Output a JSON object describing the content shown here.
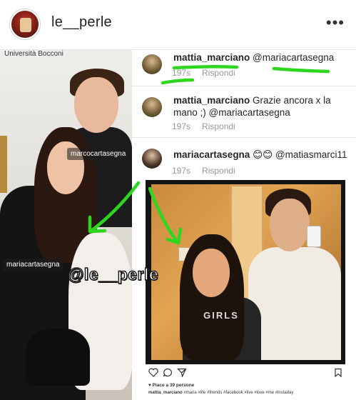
{
  "header": {
    "username": "le__perle",
    "more_label": "•••"
  },
  "left_photo": {
    "caption_top": "Università Bocconi",
    "tags": [
      "marcocartasegna",
      "mariacartasegna"
    ]
  },
  "comments": [
    {
      "user": "mattia_marciano",
      "text": " @mariacartasegna",
      "time": "197s",
      "reply": "Rispondi"
    },
    {
      "user": "mattia_marciano",
      "text": " Grazie ancora x la mano ;) @mariacartasegna",
      "time": "197s",
      "reply": "Rispondi"
    },
    {
      "user": "mariacartasegna",
      "text": " 😊😊 @matiasmarci11",
      "time": "197s",
      "reply": "Rispondi"
    }
  ],
  "right_photo": {
    "shirt_print": "GIRLS"
  },
  "post_footer": {
    "likes": "♥ Piace a 39 persone",
    "caption_user": "mattia_marciano",
    "caption_tags": " #maria #life #friends #facebook #live #love #me #instaday"
  },
  "watermark": "@le__perle",
  "colors": {
    "annotation": "#2fd61f",
    "meta_gray": "#999999"
  },
  "icons": [
    "more-icon",
    "heart-icon",
    "comment-icon",
    "share-icon",
    "bookmark-icon"
  ]
}
